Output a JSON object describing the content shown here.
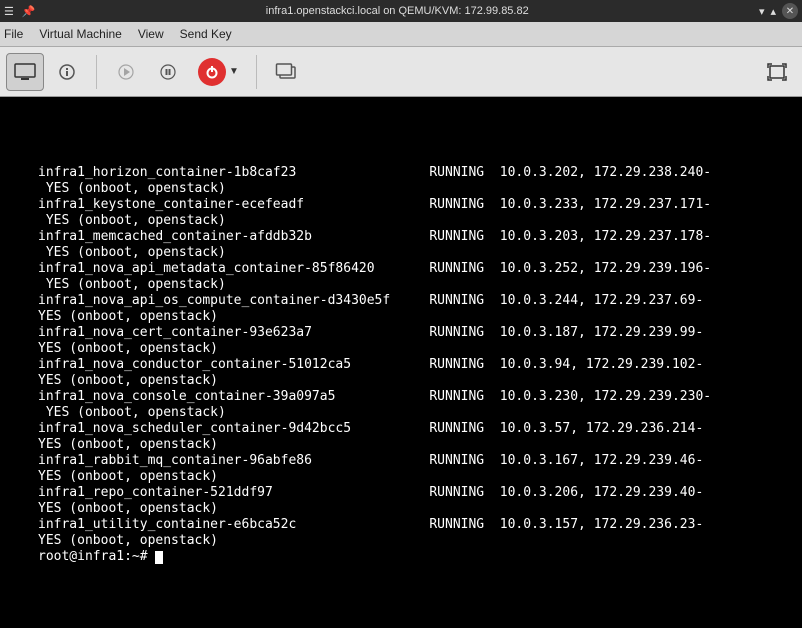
{
  "titlebar": {
    "title": "infra1.openstackci.local on QEMU/KVM: 172.99.85.82"
  },
  "menubar": {
    "file": "File",
    "vm": "Virtual Machine",
    "view": "View",
    "sendkey": "Send Key"
  },
  "terminal": {
    "containers": [
      {
        "name": "infra1_horizon_container-1b8caf23",
        "state": "RUNNING",
        "ips": "10.0.3.202, 172.29.238.240",
        "auto": "YES (onboot, openstack)"
      },
      {
        "name": "infra1_keystone_container-ecefeadf",
        "state": "RUNNING",
        "ips": "10.0.3.233, 172.29.237.171",
        "auto": "YES (onboot, openstack)"
      },
      {
        "name": "infra1_memcached_container-afddb32b",
        "state": "RUNNING",
        "ips": "10.0.3.203, 172.29.237.178",
        "auto": "YES (onboot, openstack)"
      },
      {
        "name": "infra1_nova_api_metadata_container-85f86420",
        "state": "RUNNING",
        "ips": "10.0.3.252, 172.29.239.196",
        "auto": "YES (onboot, openstack)"
      },
      {
        "name": "infra1_nova_api_os_compute_container-d3430e5f",
        "state": "RUNNING",
        "ips": "10.0.3.244, 172.29.237.69",
        "auto": "YES (onboot, openstack)"
      },
      {
        "name": "infra1_nova_cert_container-93e623a7",
        "state": "RUNNING",
        "ips": "10.0.3.187, 172.29.239.99",
        "auto": "YES (onboot, openstack)"
      },
      {
        "name": "infra1_nova_conductor_container-51012ca5",
        "state": "RUNNING",
        "ips": "10.0.3.94, 172.29.239.102",
        "auto": "YES (onboot, openstack)"
      },
      {
        "name": "infra1_nova_console_container-39a097a5",
        "state": "RUNNING",
        "ips": "10.0.3.230, 172.29.239.230",
        "auto": "YES (onboot, openstack)"
      },
      {
        "name": "infra1_nova_scheduler_container-9d42bcc5",
        "state": "RUNNING",
        "ips": "10.0.3.57, 172.29.236.214",
        "auto": "YES (onboot, openstack)"
      },
      {
        "name": "infra1_rabbit_mq_container-96abfe86",
        "state": "RUNNING",
        "ips": "10.0.3.167, 172.29.239.46",
        "auto": "YES (onboot, openstack)"
      },
      {
        "name": "infra1_repo_container-521ddf97",
        "state": "RUNNING",
        "ips": "10.0.3.206, 172.29.239.40",
        "auto": "YES (onboot, openstack)"
      },
      {
        "name": "infra1_utility_container-e6bca52c",
        "state": "RUNNING",
        "ips": "10.0.3.157, 172.29.236.23",
        "auto": "YES (onboot, openstack)"
      }
    ],
    "prompt": "root@infra1:~# ",
    "wrap_width": 90,
    "name_col_width": 50
  }
}
